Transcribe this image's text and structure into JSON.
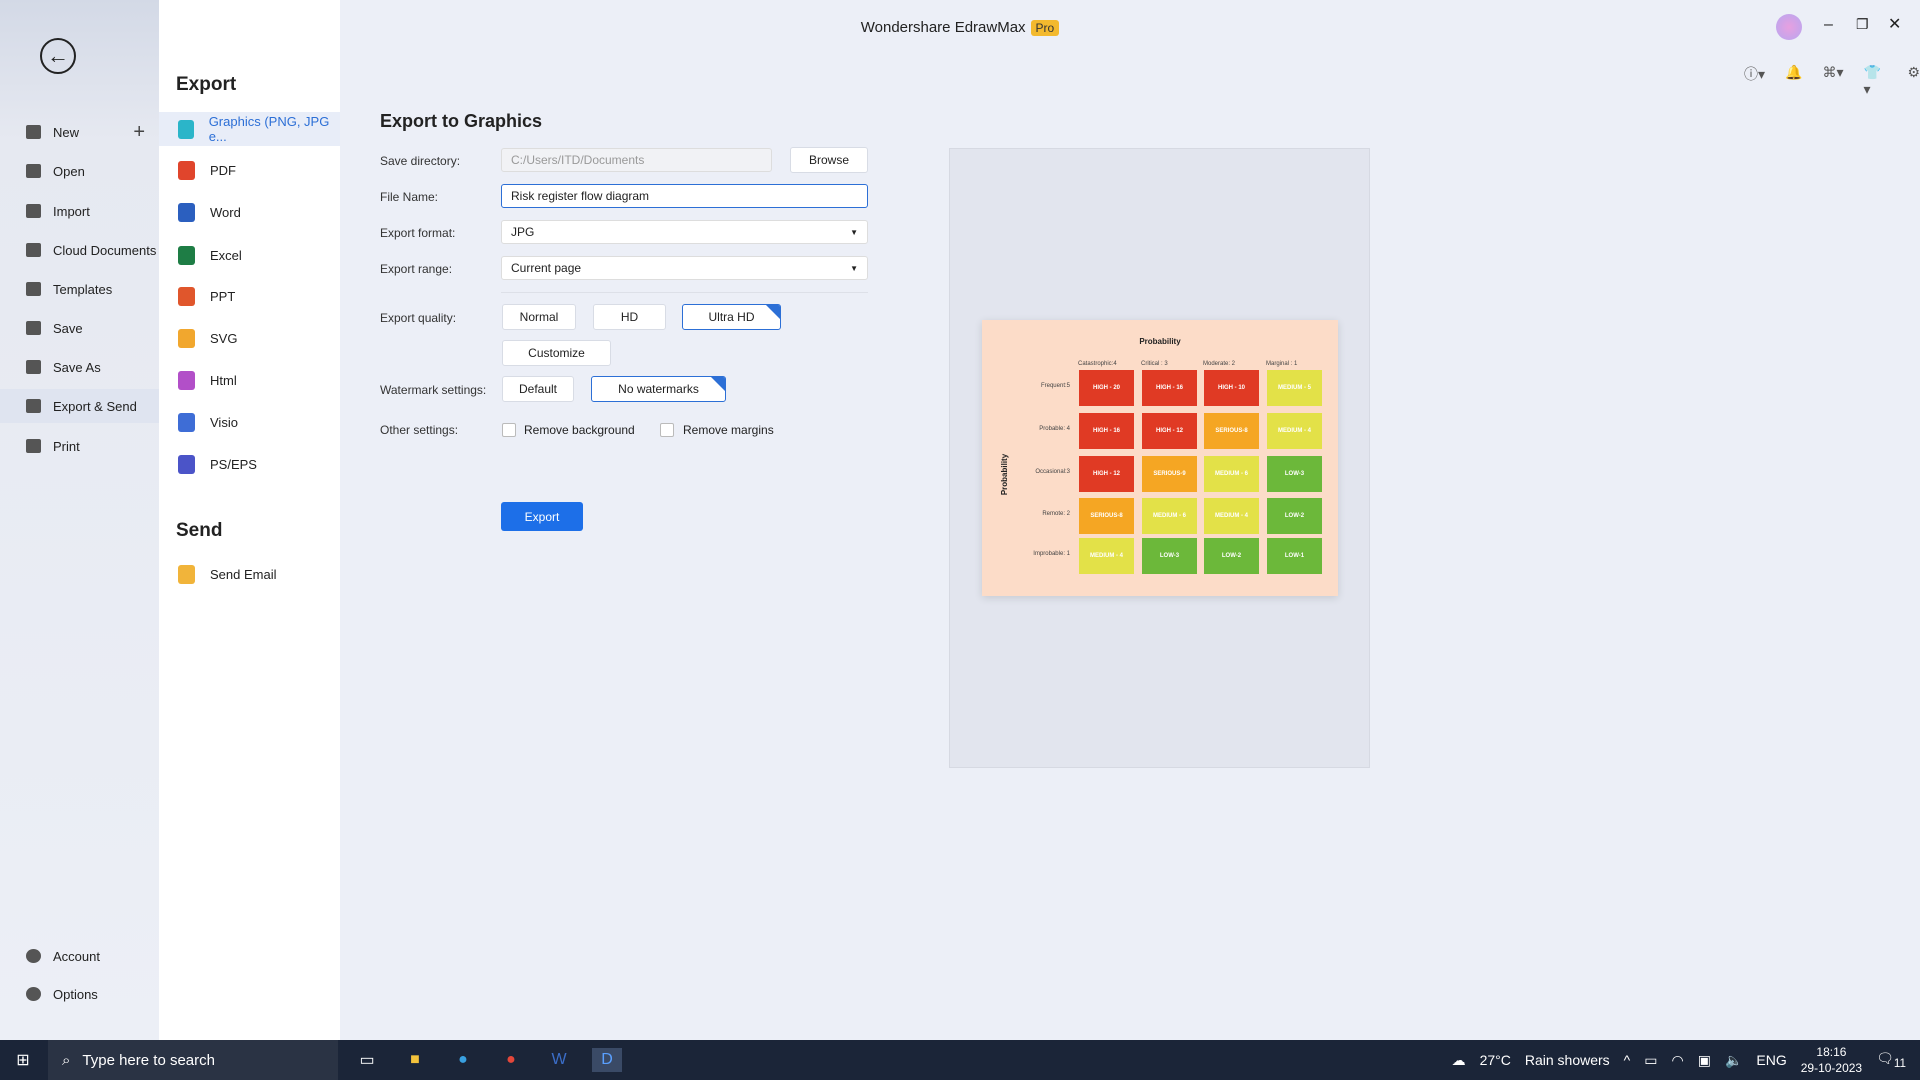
{
  "app": {
    "title": "Wondershare EdrawMax",
    "badge": "Pro"
  },
  "sidebar": {
    "items": [
      {
        "label": "New"
      },
      {
        "label": "Open"
      },
      {
        "label": "Import"
      },
      {
        "label": "Cloud Documents"
      },
      {
        "label": "Templates"
      },
      {
        "label": "Save"
      },
      {
        "label": "Save As"
      },
      {
        "label": "Export & Send",
        "active": true
      },
      {
        "label": "Print"
      }
    ],
    "bottom": [
      {
        "label": "Account"
      },
      {
        "label": "Options"
      }
    ]
  },
  "export_panel": {
    "heading": "Export",
    "items": [
      {
        "label": "Graphics (PNG, JPG e...",
        "color": "#2bb5c9",
        "active": true
      },
      {
        "label": "PDF",
        "color": "#e0452c"
      },
      {
        "label": "Word",
        "color": "#2b5fbf"
      },
      {
        "label": "Excel",
        "color": "#1e7d45"
      },
      {
        "label": "PPT",
        "color": "#e0562c"
      },
      {
        "label": "SVG",
        "color": "#f1a72e"
      },
      {
        "label": "Html",
        "color": "#b24fc8"
      },
      {
        "label": "Visio",
        "color": "#3e6dd6"
      },
      {
        "label": "PS/EPS",
        "color": "#4b54c8"
      }
    ],
    "send_heading": "Send",
    "send_items": [
      {
        "label": "Send Email",
        "color": "#f1b43a"
      }
    ]
  },
  "form": {
    "title": "Export to Graphics",
    "save_directory": {
      "label": "Save directory:",
      "value": "C:/Users/ITD/Documents",
      "browse": "Browse"
    },
    "file_name": {
      "label": "File Name:",
      "value": "Risk register flow diagram"
    },
    "export_format": {
      "label": "Export format:",
      "value": "JPG"
    },
    "export_range": {
      "label": "Export range:",
      "value": "Current page"
    },
    "quality": {
      "label": "Export quality:",
      "options": [
        "Normal",
        "HD",
        "Ultra HD"
      ],
      "selected": "Ultra HD",
      "customize": "Customize"
    },
    "watermark": {
      "label": "Watermark settings:",
      "options": [
        "Default",
        "No watermarks"
      ],
      "selected": "No watermarks"
    },
    "other": {
      "label": "Other settings:",
      "remove_background": "Remove background",
      "remove_margins": "Remove margins"
    },
    "export_button": "Export"
  },
  "preview": {
    "title": "Probability",
    "side_label": "Probability",
    "columns": [
      "Catastrophic:4",
      "Critical : 3",
      "Moderate: 2",
      "Marginal : 1"
    ],
    "rows": [
      {
        "label": "Frequent:5",
        "cells": [
          [
            "HIGH - 20",
            "#e03a24"
          ],
          [
            "HIGH - 16",
            "#e03a24"
          ],
          [
            "HIGH - 10",
            "#e03a24"
          ],
          [
            "MEDIUM - 5",
            "#e3e148"
          ]
        ]
      },
      {
        "label": "Probable: 4",
        "cells": [
          [
            "HIGH - 16",
            "#e03a24"
          ],
          [
            "HIGH - 12",
            "#e03a24"
          ],
          [
            "SERIOUS-8",
            "#f5a623"
          ],
          [
            "MEDIUM - 4",
            "#e3e148"
          ]
        ]
      },
      {
        "label": "Occasional:3",
        "cells": [
          [
            "HIGH - 12",
            "#e03a24"
          ],
          [
            "SERIOUS-9",
            "#f5a623"
          ],
          [
            "MEDIUM - 6",
            "#e3e148"
          ],
          [
            "LOW-3",
            "#6cb83a"
          ]
        ]
      },
      {
        "label": "Remote: 2",
        "cells": [
          [
            "SERIOUS-8",
            "#f5a623"
          ],
          [
            "MEDIUM - 6",
            "#e3e148"
          ],
          [
            "MEDIUM - 4",
            "#e3e148"
          ],
          [
            "LOW-2",
            "#6cb83a"
          ]
        ]
      },
      {
        "label": "Improbable: 1",
        "cells": [
          [
            "MEDIUM - 4",
            "#e3e148"
          ],
          [
            "LOW-3",
            "#6cb83a"
          ],
          [
            "LOW-2",
            "#6cb83a"
          ],
          [
            "LOW-1",
            "#6cb83a"
          ]
        ]
      }
    ]
  },
  "taskbar": {
    "search_placeholder": "Type here to search",
    "weather": "27°C",
    "weather_desc": "Rain showers",
    "lang": "ENG",
    "time": "18:16",
    "date": "29-10-2023",
    "notifications": "11"
  }
}
